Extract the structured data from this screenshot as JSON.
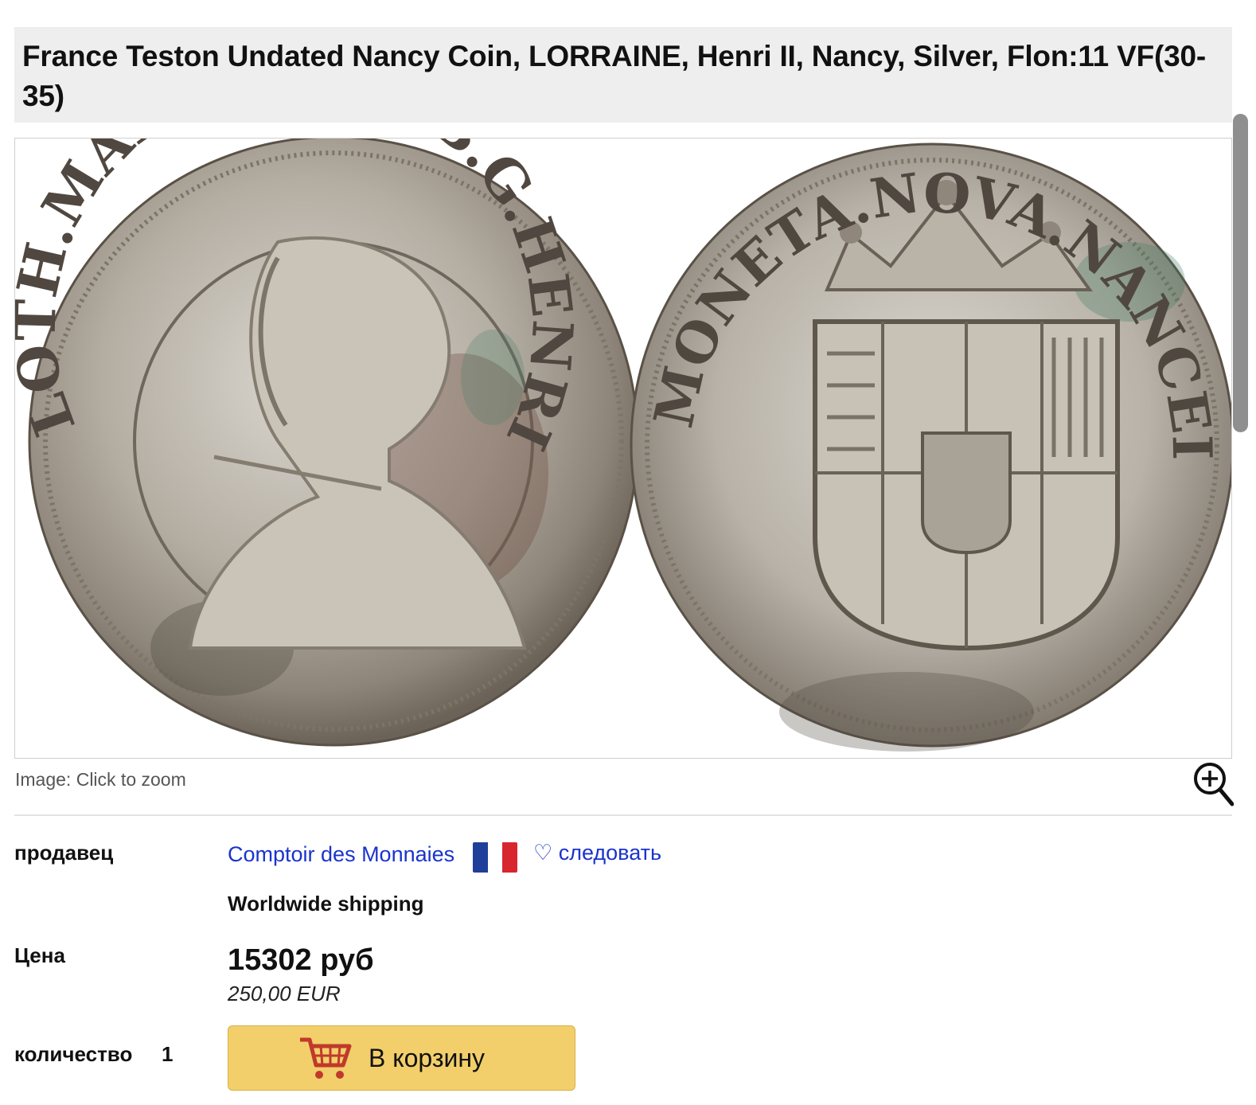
{
  "product": {
    "title": "France Teston Undated Nancy Coin, LORRAINE, Henri II, Nancy, Silver, Flon:11 VF(30-35)"
  },
  "image": {
    "caption": "Image: Click to zoom",
    "obverse_legend": "LOTH.MAR.CH.D.C.B.G.HENRICUS",
    "reverse_legend": "MONETA.NOVA.NANCEII.CVSA"
  },
  "seller": {
    "label": "продавец",
    "name": "Comptoir des Monnaies",
    "follow": "♡ следовать",
    "shipping": "Worldwide shipping"
  },
  "price": {
    "label": "Цена",
    "main": "15302 руб",
    "secondary": "250,00 EUR"
  },
  "quantity": {
    "label": "количество",
    "value": "1"
  },
  "cart": {
    "label": "В корзину"
  },
  "colors": {
    "title_bg": "#eeeeee",
    "link": "#1a33cc",
    "cart_button": "#f2cf6b",
    "cart_icon": "#c0392b"
  },
  "icons": [
    "zoom-in-icon",
    "cart-icon",
    "heart-icon",
    "french-flag-icon"
  ]
}
